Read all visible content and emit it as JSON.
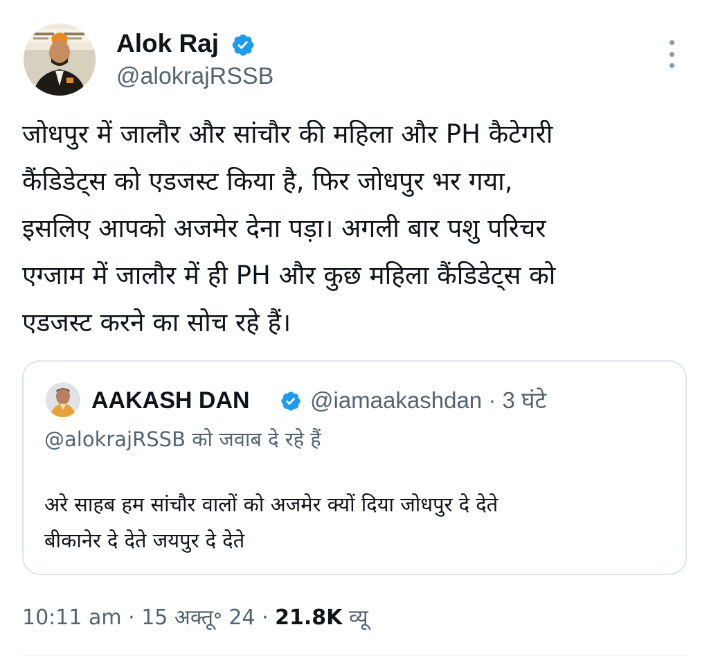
{
  "author": {
    "name": "Alok Raj",
    "handle": "@alokrajRSSB",
    "verified": true
  },
  "tweet": {
    "text": "जोधपुर में जालौर और सांचौर की महिला और PH कैटेगरी\nकैंडिडेट्स को एडजस्ट किया है, फिर जोधपुर भर गया,\nइसलिए आपको अजमेर देना पड़ा। अगली बार पशु परिचर\nएग्जाम में जालौर में ही PH और कुछ महिला कैंडिडेट्स को\nएडजस्ट करने का सोच रहे हैं।"
  },
  "quoted_tweet": {
    "name": "AAKASH DAN",
    "handle": "@iamaakashdan",
    "time": " · 3 घंटे",
    "replying_to": "@alokrajRSSB को जवाब दे रहे हैं",
    "text": "अरे साहब हम सांचौर वालों को अजमेर क्यों दिया जोधपुर दे देते\nबीकानेर दे देते जयपुर दे देते"
  },
  "meta": {
    "time": "10:11 am",
    "separator": " · ",
    "date": "15 अक्तू॰ 24",
    "views_count": "21.8K",
    "views_label": " व्यू"
  },
  "colors": {
    "verified_blue": "#1d9bf0",
    "text_primary": "#0f1419",
    "text_secondary": "#536471",
    "border": "#dfe4e8"
  },
  "icons": {
    "verified": "verified-badge-icon",
    "more": "more-options-icon"
  }
}
